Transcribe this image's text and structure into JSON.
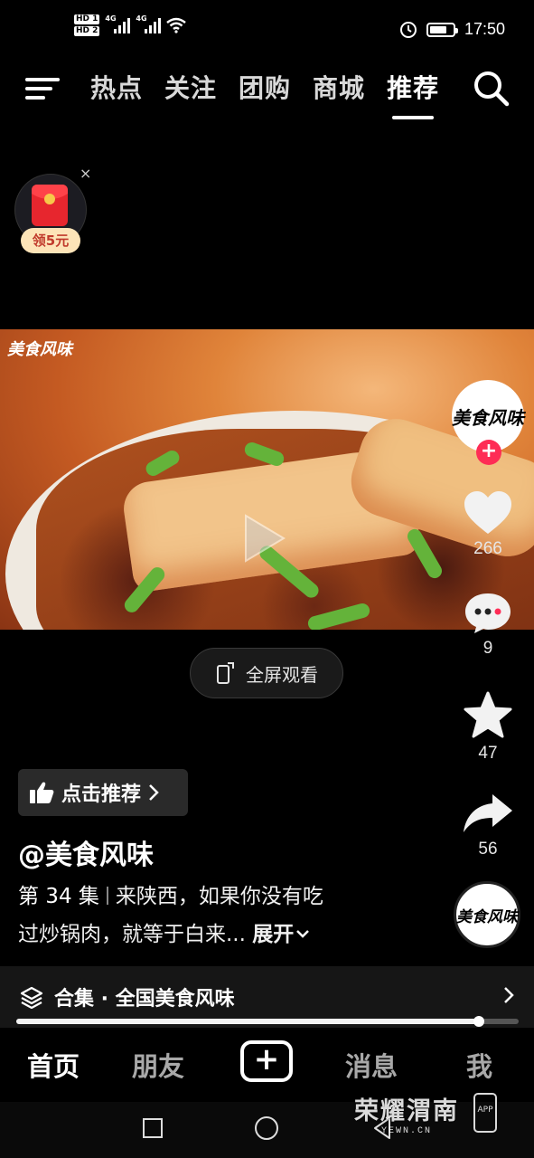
{
  "status_bar": {
    "hd1": "HD 1",
    "hd2": "HD 2",
    "net1": "4G",
    "net2": "4G",
    "time": "17:50"
  },
  "top_nav": {
    "tabs": [
      {
        "label": "热点"
      },
      {
        "label": "关注"
      },
      {
        "label": "团购"
      },
      {
        "label": "商城"
      },
      {
        "label": "推荐",
        "active": true
      }
    ]
  },
  "red_packet": {
    "label": "领5元",
    "close": "×"
  },
  "video": {
    "watermark": "美食风味"
  },
  "fullscreen": {
    "label": "全屏观看"
  },
  "right_rail": {
    "avatar_text": "美食风味",
    "follow": "+",
    "likes": "266",
    "comments": "9",
    "favorites": "47",
    "shares": "56",
    "disc_text": "美食风味"
  },
  "info": {
    "recommend_label": "点击推荐",
    "author": "@美食风味",
    "episode": "第 34 集",
    "description_line1": "来陕西，如果你没有吃",
    "description_line2": "过炒锅肉，就等于白来...",
    "expand": "展开"
  },
  "collection": {
    "label": "合集 · 全国美食风味"
  },
  "playback": {
    "progress": 0.92
  },
  "bottom_tabs": {
    "home": "首页",
    "friends": "朋友",
    "plus": "+",
    "messages": "消息",
    "me": "我"
  },
  "watermark": {
    "title": "荣耀渭南",
    "url": "YEWN.CN",
    "app": "APP"
  },
  "icons": {
    "menu": "menu-icon",
    "search": "search-icon",
    "heart": "heart-icon",
    "comment": "comment-icon",
    "star": "star-icon",
    "share": "share-icon",
    "thumb": "thumbs-up-icon",
    "layers": "layers-icon",
    "chevron": "chevron-right-icon"
  },
  "colors": {
    "accent": "#fe2c55",
    "background": "#000000",
    "red_packet": "#e7262e"
  }
}
